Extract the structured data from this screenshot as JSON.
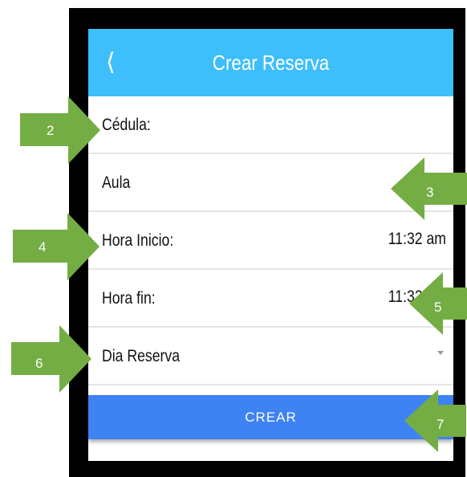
{
  "header": {
    "back_icon": "chevron-left",
    "title": "Crear Reserva"
  },
  "form": {
    "cedula_label": "Cédula:",
    "aula_label": "Aula",
    "hora_inicio_label": "Hora Inicio:",
    "hora_inicio_value": "11:32 am",
    "hora_fin_label": "Hora fin:",
    "hora_fin_value": "11:32 am",
    "dia_reserva_label": "Dia Reserva"
  },
  "submit_label": "CREAR",
  "callouts": [
    "2",
    "3",
    "4",
    "5",
    "6",
    "7"
  ],
  "colors": {
    "header": "#3ebefa",
    "button": "#3e82f4",
    "callout": "#74ad44"
  }
}
